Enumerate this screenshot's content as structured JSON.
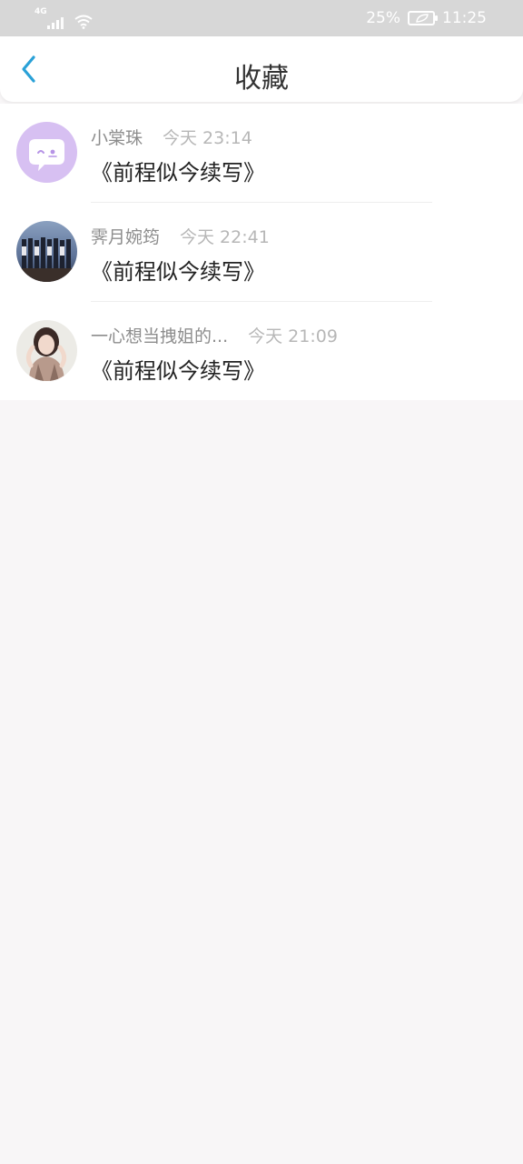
{
  "status_bar": {
    "network": "4G",
    "battery": "25%",
    "time": "11:25"
  },
  "header": {
    "title": "收藏",
    "back_icon": "chevron-left-icon"
  },
  "favorites": [
    {
      "name": "小棠珠",
      "time": "今天 23:14",
      "content": "《前程似今续写》"
    },
    {
      "name": "霁月婉筠",
      "time": "今天 22:41",
      "content": "《前程似今续写》"
    },
    {
      "name": "一心想当拽姐的...",
      "time": "今天 21:09",
      "content": "《前程似今续写》"
    }
  ],
  "colors": {
    "accent": "#2aa1d7",
    "status_bar": "#d7d7d7",
    "background": "#f8f6f7"
  }
}
